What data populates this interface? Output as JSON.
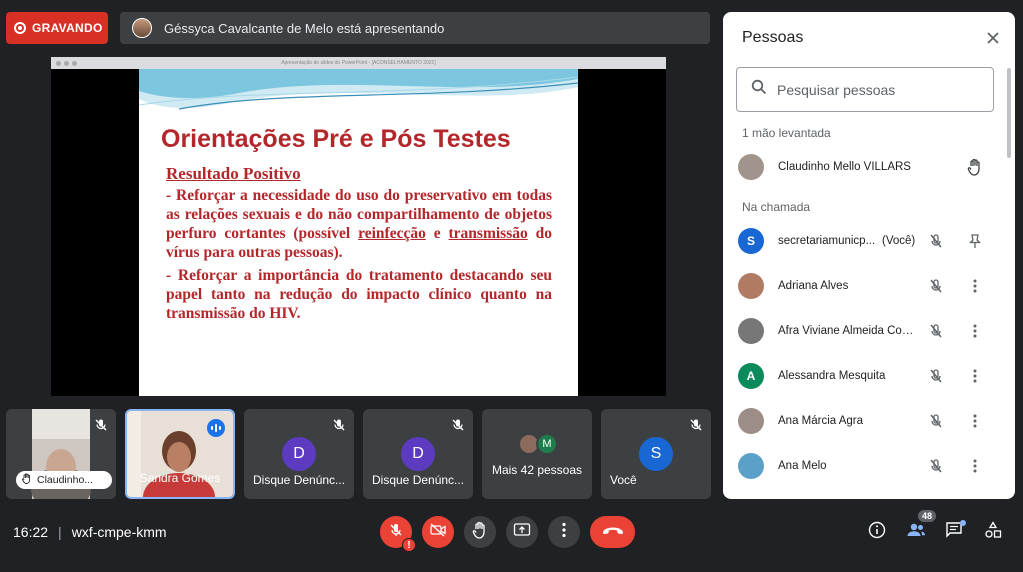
{
  "recording": {
    "label": "GRAVANDO"
  },
  "presenting": {
    "text": "Géssyca Cavalcante de Melo está apresentando"
  },
  "presentation": {
    "window_title": "Apresentação de slides do PowerPoint - [ACONSELHAMENTO 2021]",
    "slide_title": "Orientações Pré e Pós Testes",
    "subtitle": "Resultado Positivo",
    "para1_a": "- Reforçar a necessidade do uso do preservativo em todas as relações sexuais e do não compartilhamento de objetos perfuro cortantes (possível ",
    "para1_b": "reinfecção",
    "para1_c": " e ",
    "para1_d": "transmissão",
    "para1_e": " do vírus para outras pessoas).",
    "para2": "- Reforçar a importância do tratamento destacando seu papel tanto na redução do impacto clínico quanto na transmissão do HIV."
  },
  "tiles": [
    {
      "name": "Claudinho...",
      "type": "video-hand"
    },
    {
      "name": "Sandra Gomes",
      "type": "video-speaking"
    },
    {
      "name": "Disque Denúnc...",
      "initial": "D",
      "color": "#5c3bc1"
    },
    {
      "name": "Disque Denúnc...",
      "initial": "D",
      "color": "#5c3bc1"
    },
    {
      "name": "Mais 42 pessoas",
      "initial": "M",
      "color": "#1e7d4a"
    },
    {
      "name": "Você",
      "initial": "S",
      "color": "#1967d2"
    }
  ],
  "bottom_bar": {
    "time": "16:22",
    "separator": "|",
    "meeting_code": "wxf-cmpe-kmm",
    "people_count": "48",
    "warning": "!"
  },
  "people_panel": {
    "title": "Pessoas",
    "search_placeholder": "Pesquisar pessoas",
    "raised_label": "1 mão levantada",
    "in_call_label": "Na chamada",
    "raised": [
      {
        "name": "Claudinho Mello VILLARS"
      }
    ],
    "people": [
      {
        "name": "secretariamunicp...",
        "you": "(Você)",
        "initial": "S",
        "color": "#1967d2"
      },
      {
        "name": "Adriana Alves",
        "initial": "",
        "color": "#b07a63"
      },
      {
        "name": "Afra Viviane Almeida Cout...",
        "initial": "",
        "color": "#777777"
      },
      {
        "name": "Alessandra Mesquita",
        "initial": "A",
        "color": "#0b8a5b"
      },
      {
        "name": "Ana Márcia Agra",
        "initial": "",
        "color": "#9c8e86"
      },
      {
        "name": "Ana Melo",
        "initial": "",
        "color": "#5aa0c8"
      }
    ]
  }
}
